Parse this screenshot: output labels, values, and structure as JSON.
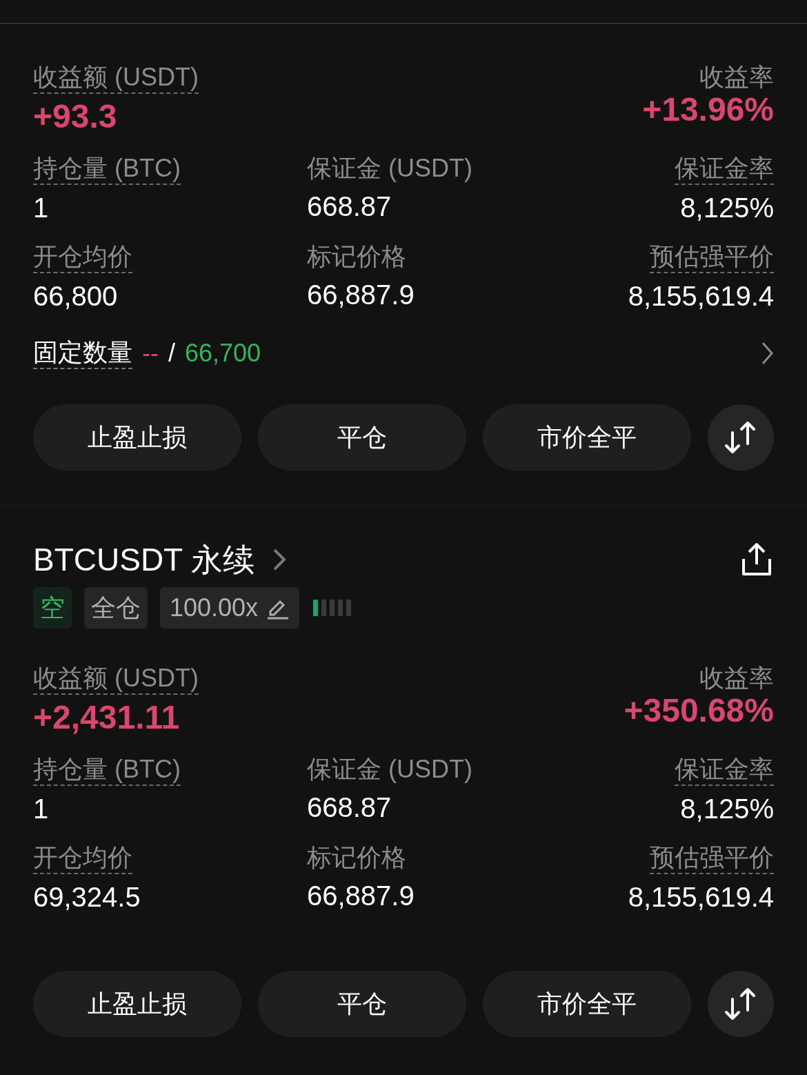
{
  "positions": [
    {
      "pnl": {
        "label": "收益额 (USDT)",
        "value": "+93.3"
      },
      "roe": {
        "label": "收益率",
        "value": "+13.96%"
      },
      "stats": [
        {
          "label": "持仓量 (BTC)",
          "value": "1",
          "underlined": true
        },
        {
          "label": "保证金 (USDT)",
          "value": "668.87",
          "underlined": false
        },
        {
          "label": "保证金率",
          "value": "8,125%",
          "underlined": true
        },
        {
          "label": "开仓均价",
          "value": "66,800",
          "underlined": true
        },
        {
          "label": "标记价格",
          "value": "66,887.9",
          "underlined": false
        },
        {
          "label": "预估强平价",
          "value": "8,155,619.4",
          "underlined": true
        }
      ],
      "tp_sl": {
        "label": "固定数量",
        "take_profit": "--",
        "separator": "/",
        "stop_loss": "66,700"
      },
      "buttons": [
        "止盈止损",
        "平仓",
        "市价全平"
      ]
    },
    {
      "header": {
        "symbol": "BTCUSDT 永续",
        "side": "空",
        "margin_mode": "全仓",
        "leverage": "100.00x",
        "risk": {
          "level": 0.2
        }
      },
      "pnl": {
        "label": "收益额 (USDT)",
        "value": "+2,431.11"
      },
      "roe": {
        "label": "收益率",
        "value": "+350.68%"
      },
      "stats": [
        {
          "label": "持仓量 (BTC)",
          "value": "1",
          "underlined": true
        },
        {
          "label": "保证金 (USDT)",
          "value": "668.87",
          "underlined": false
        },
        {
          "label": "保证金率",
          "value": "8,125%",
          "underlined": true
        },
        {
          "label": "开仓均价",
          "value": "69,324.5",
          "underlined": true
        },
        {
          "label": "标记价格",
          "value": "66,887.9",
          "underlined": false
        },
        {
          "label": "预估强平价",
          "value": "8,155,619.4",
          "underlined": true
        }
      ],
      "buttons": [
        "止盈止损",
        "平仓",
        "市价全平"
      ]
    }
  ]
}
